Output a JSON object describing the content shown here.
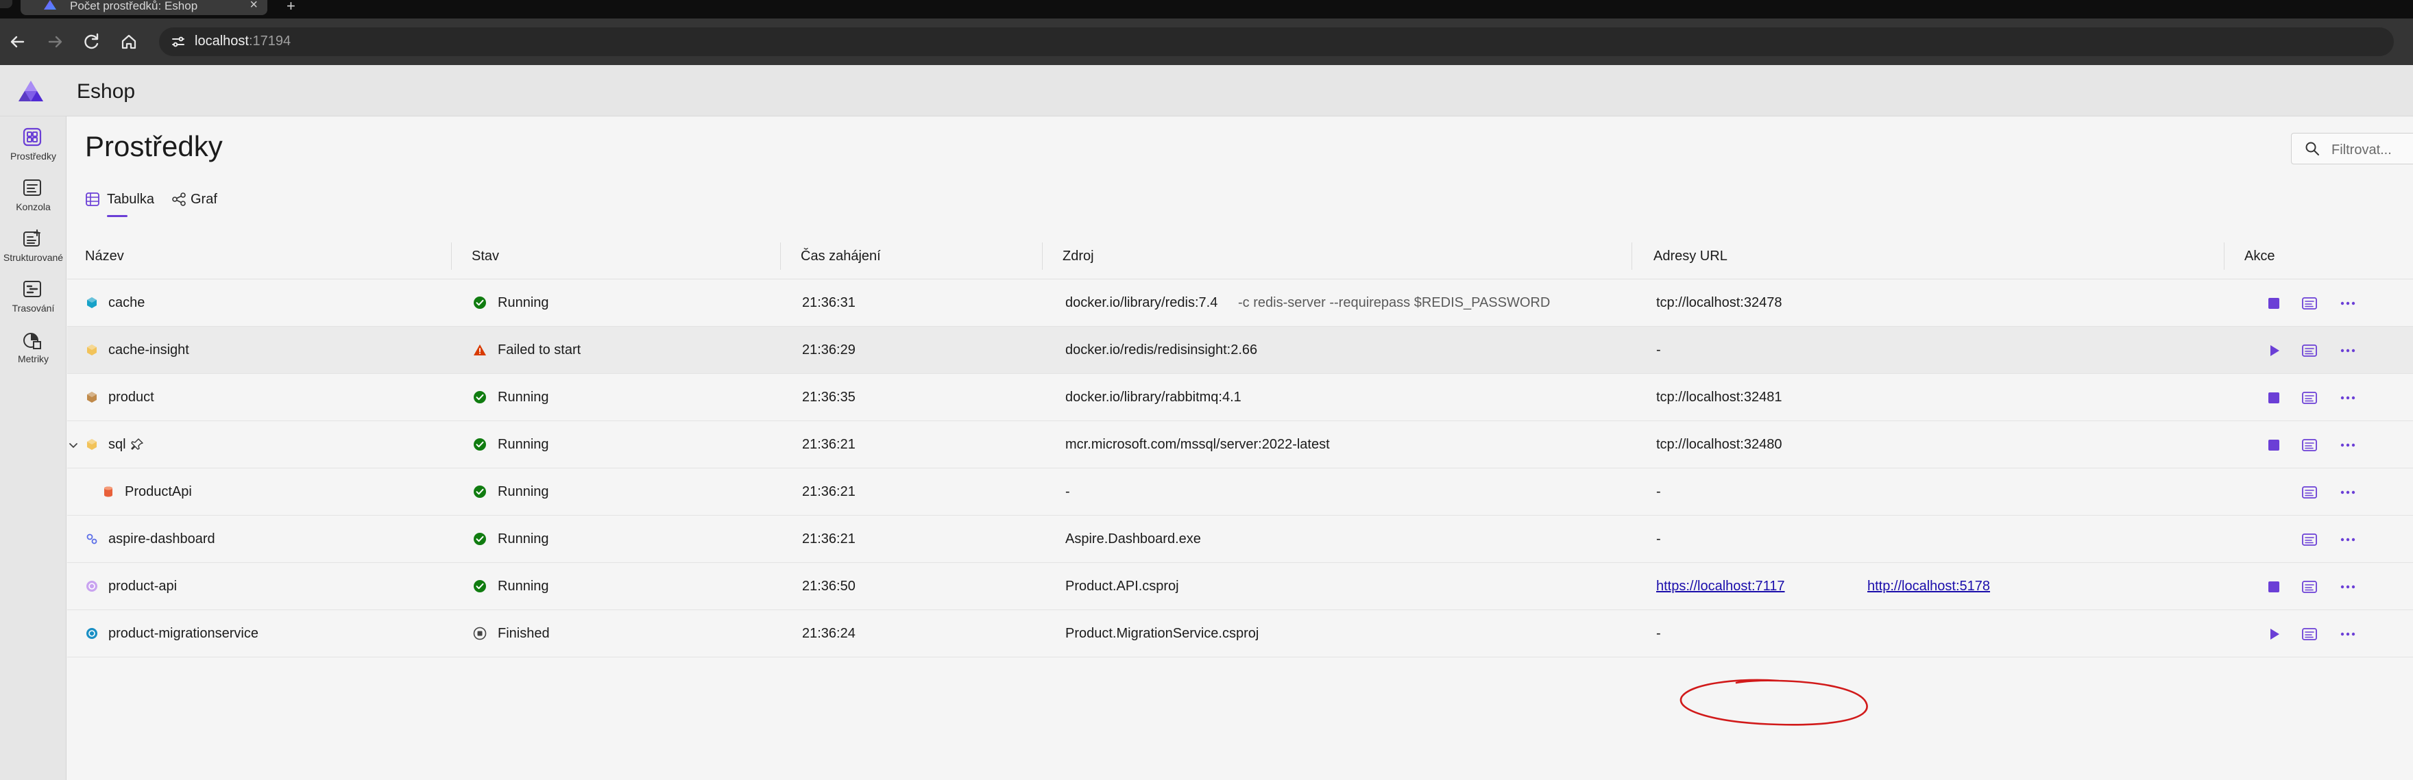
{
  "browser": {
    "tab_title": "Počet prostředků: Eshop",
    "tab_close": "×",
    "new_tab": "+",
    "url_host": "localhost",
    "url_port": ":17194"
  },
  "app": {
    "name": "Eshop"
  },
  "sidebar": {
    "items": [
      {
        "label": "Prostředky",
        "icon": "resources-icon",
        "active": true
      },
      {
        "label": "Konzola",
        "icon": "console-icon",
        "active": false
      },
      {
        "label": "Strukturované",
        "icon": "structured-logs-icon",
        "active": false
      },
      {
        "label": "Trasování",
        "icon": "traces-icon",
        "active": false
      },
      {
        "label": "Metriky",
        "icon": "metrics-icon",
        "active": false
      }
    ]
  },
  "page": {
    "title": "Prostředky",
    "filter_placeholder": "Filtrovat..."
  },
  "view_tabs": [
    {
      "label": "Tabulka",
      "icon": "table-icon",
      "selected": true
    },
    {
      "label": "Graf",
      "icon": "graph-icon",
      "selected": false
    }
  ],
  "table": {
    "columns": [
      "Název",
      "Stav",
      "Čas zahájení",
      "Zdroj",
      "Adresy URL",
      "Akce"
    ],
    "rows": [
      {
        "name": "cache",
        "resource_icon": "container-icon",
        "status": "Running",
        "status_icon": "running-check-icon",
        "start_time": "21:36:31",
        "source": "docker.io/library/redis:7.4",
        "source_args": "-c redis-server --requirepass $REDIS_PASSWORD",
        "url1": "tcp://localhost:32478",
        "url2": "",
        "action": "stop"
      },
      {
        "name": "cache-insight",
        "resource_icon": "container-icon",
        "status": "Failed to start",
        "status_icon": "warning-icon",
        "start_time": "21:36:29",
        "source": "docker.io/redis/redisinsight:2.66",
        "source_args": "",
        "url1": "-",
        "url2": "",
        "action": "start"
      },
      {
        "name": "product",
        "resource_icon": "container-icon",
        "status": "Running",
        "status_icon": "running-check-icon",
        "start_time": "21:36:35",
        "source": "docker.io/library/rabbitmq:4.1",
        "source_args": "",
        "url1": "tcp://localhost:32481",
        "url2": "",
        "action": "stop"
      },
      {
        "name": "sql",
        "resource_icon": "container-icon",
        "status": "Running",
        "status_icon": "running-check-icon",
        "start_time": "21:36:21",
        "source": "mcr.microsoft.com/mssql/server:2022-latest",
        "source_args": "",
        "url1": "tcp://localhost:32480",
        "url2": "",
        "action": "stop"
      },
      {
        "name": "ProductApi",
        "resource_icon": "database-icon",
        "status": "Running",
        "status_icon": "running-check-icon",
        "start_time": "21:36:21",
        "source": "-",
        "source_args": "",
        "url1": "-",
        "url2": "",
        "action": "none"
      },
      {
        "name": "aspire-dashboard",
        "resource_icon": "executable-icon",
        "status": "Running",
        "status_icon": "running-check-icon",
        "start_time": "21:36:21",
        "source": "Aspire.Dashboard.exe",
        "source_args": "",
        "url1": "-",
        "url2": "",
        "action": "none"
      },
      {
        "name": "product-api",
        "resource_icon": "project-icon",
        "status": "Running",
        "status_icon": "running-check-icon",
        "start_time": "21:36:50",
        "source": "Product.API.csproj",
        "source_args": "",
        "url1": "https://localhost:7117",
        "url2": "http://localhost:5178",
        "action": "stop"
      },
      {
        "name": "product-migrationservice",
        "resource_icon": "project-icon",
        "status": "Finished",
        "status_icon": "finished-icon",
        "start_time": "21:36:24",
        "source": "Product.MigrationService.csproj",
        "source_args": "",
        "url1": "-",
        "url2": "",
        "action": "start"
      }
    ]
  },
  "colors": {
    "accent": "#6b3fd6",
    "running": "#107c10",
    "warning": "#d83b01",
    "annotation": "#d11a1a"
  }
}
